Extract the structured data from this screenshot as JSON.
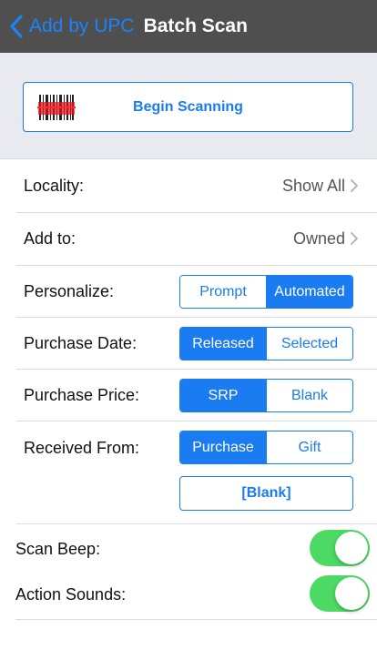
{
  "navbar": {
    "back_label": "Add by UPC",
    "title": "Batch Scan"
  },
  "scan": {
    "button_label": "Begin Scanning",
    "icon": "barcode-icon"
  },
  "locality": {
    "label": "Locality:",
    "value": "Show All"
  },
  "add_to": {
    "label": "Add to:",
    "value": "Owned"
  },
  "personalize": {
    "label": "Personalize:",
    "options": [
      "Prompt",
      "Automated"
    ],
    "selected": "Automated"
  },
  "purchase_date": {
    "label": "Purchase Date:",
    "options": [
      "Released",
      "Selected"
    ],
    "selected": "Released"
  },
  "purchase_price": {
    "label": "Purchase Price:",
    "options": [
      "SRP",
      "Blank"
    ],
    "selected": "SRP"
  },
  "received_from": {
    "label": "Received From:",
    "options": [
      "Purchase",
      "Gift"
    ],
    "selected": "Purchase",
    "extra_button": "[Blank]"
  },
  "scan_beep": {
    "label": "Scan Beep:",
    "on": true
  },
  "action_sounds": {
    "label": "Action Sounds:",
    "on": true
  },
  "colors": {
    "accent": "#1a7cf0",
    "navbar": "#4f4f4f",
    "toggle_on": "#4cd964",
    "section_bg": "#e9e9f0"
  }
}
